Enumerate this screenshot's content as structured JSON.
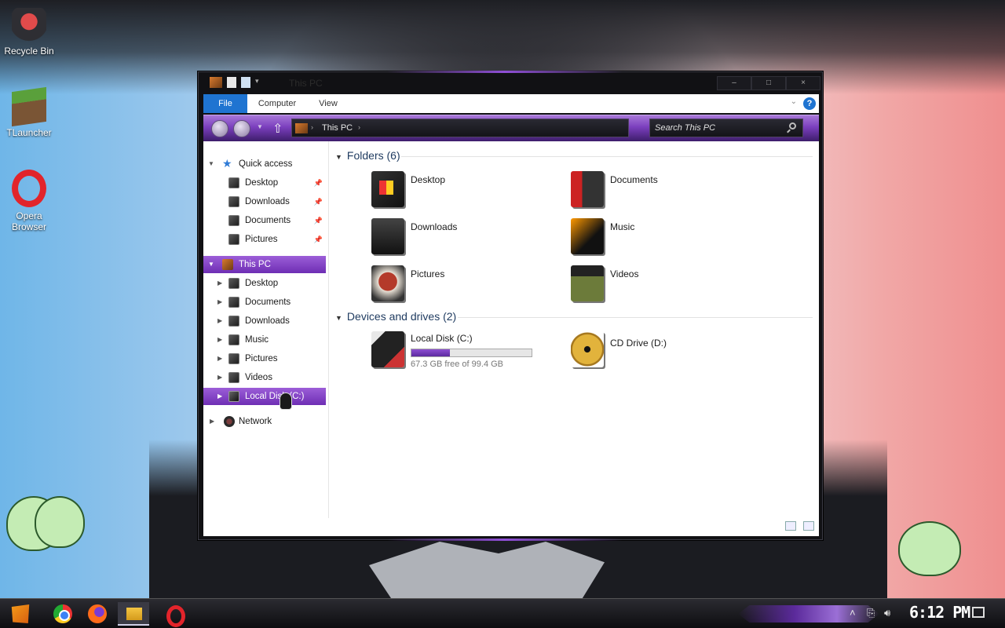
{
  "desktop": {
    "icons": [
      {
        "label": "Recycle Bin"
      },
      {
        "label": "TLauncher"
      },
      {
        "label": "Opera Browser"
      }
    ]
  },
  "window": {
    "title": "This PC",
    "controls": {
      "minimize": "–",
      "maximize": "□",
      "close": "×"
    },
    "ribbon": {
      "tabs": [
        "File",
        "Computer",
        "View"
      ],
      "help": "?"
    },
    "address": {
      "crumb": "This PC"
    },
    "search": {
      "placeholder": "Search This PC"
    }
  },
  "navpane": {
    "quick_access": {
      "label": "Quick access",
      "items": [
        "Desktop",
        "Downloads",
        "Documents",
        "Pictures"
      ]
    },
    "this_pc": {
      "label": "This PC",
      "items": [
        "Desktop",
        "Documents",
        "Downloads",
        "Music",
        "Pictures",
        "Videos",
        "Local Disk (C:)"
      ]
    },
    "network": {
      "label": "Network"
    }
  },
  "content": {
    "folders_header": "Folders (6)",
    "folders": [
      "Desktop",
      "Documents",
      "Downloads",
      "Music",
      "Pictures",
      "Videos"
    ],
    "devices_header": "Devices and drives (2)",
    "drives": [
      {
        "name": "Local Disk (C:)",
        "free_text": "67.3 GB free of 99.4 GB",
        "used_fraction": 0.323
      },
      {
        "name": "CD Drive (D:)"
      }
    ]
  },
  "taskbar": {
    "apps": [
      "start",
      "chrome",
      "firefox",
      "file-explorer",
      "opera"
    ],
    "clock": "6:12 PM"
  },
  "colors": {
    "accent_purple": "#7b3fbe",
    "file_tab_blue": "#1f74d1"
  }
}
